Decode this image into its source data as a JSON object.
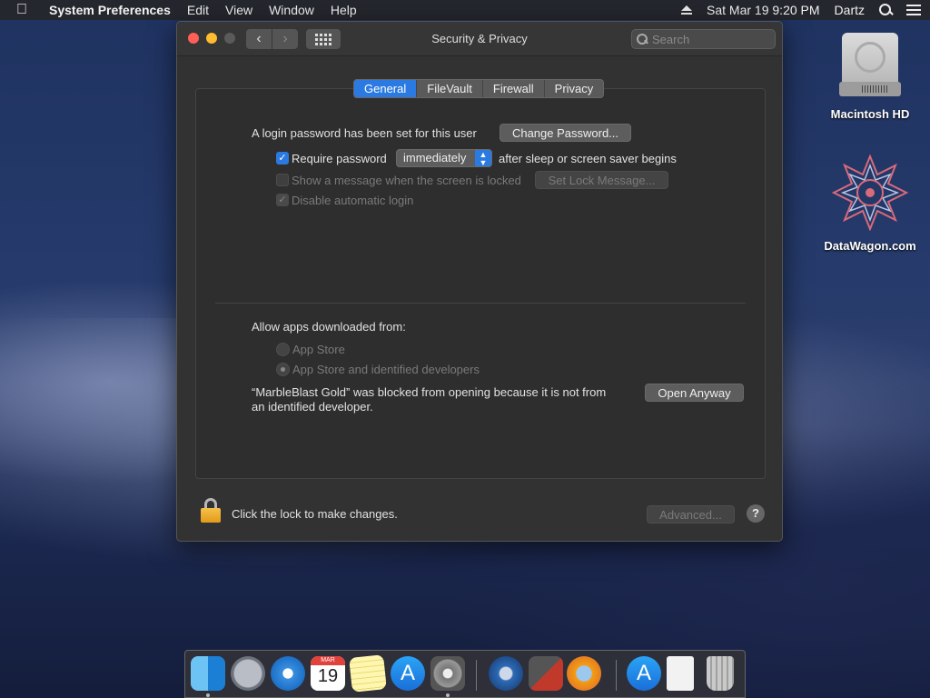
{
  "menubar": {
    "app_name": "System Preferences",
    "items": [
      "Edit",
      "View",
      "Window",
      "Help"
    ],
    "clock": "Sat Mar 19  9:20 PM",
    "user": "Dartz"
  },
  "window": {
    "title": "Security & Privacy",
    "search_placeholder": "Search",
    "tabs": [
      "General",
      "FileVault",
      "Firewall",
      "Privacy"
    ],
    "active_tab": "General",
    "login_password_text": "A login password has been set for this user",
    "change_password_button": "Change Password...",
    "require_password_label": "Require password",
    "require_password_checked": true,
    "require_password_select": "immediately",
    "after_sleep_text": "after sleep or screen saver begins",
    "show_message_label": "Show a message when the screen is locked",
    "show_message_checked": false,
    "set_lock_message_button": "Set Lock Message...",
    "disable_auto_login_label": "Disable automatic login",
    "disable_auto_login_checked": true,
    "allow_apps_label": "Allow apps downloaded from:",
    "radio_app_store": "App Store",
    "radio_identified": "App Store and identified developers",
    "selected_radio": "App Store and identified developers",
    "blocked_message_line1": "“MarbleBlast Gold” was blocked from opening because it is not from",
    "blocked_message_line2": "an identified developer.",
    "open_anyway_button": "Open Anyway",
    "lock_text": "Click the lock to make changes.",
    "advanced_button": "Advanced...",
    "help_button": "?"
  },
  "desktop": {
    "icons": [
      "Macintosh HD",
      "DataWagon.com"
    ]
  },
  "dock": {
    "calendar_month": "MAR",
    "calendar_day": "19"
  },
  "colors": {
    "accent": "#2a7ae2",
    "close": "#fe5f57",
    "minimize": "#febc2e",
    "lock": "#f5c04a"
  }
}
